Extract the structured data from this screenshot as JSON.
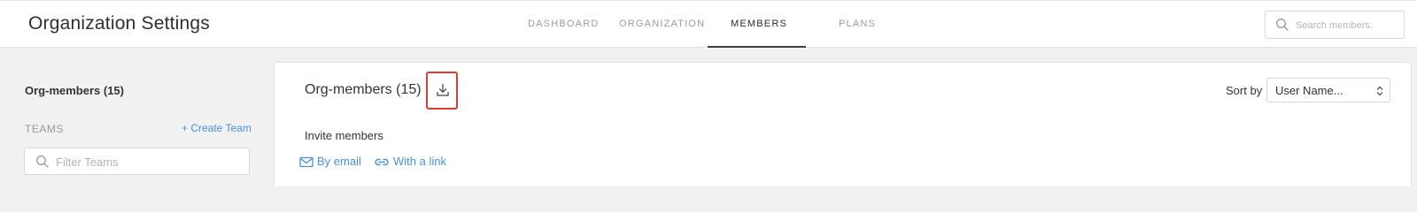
{
  "header": {
    "title": "Organization Settings",
    "tabs": [
      {
        "label": "DASHBOARD"
      },
      {
        "label": "ORGANIZATION"
      },
      {
        "label": "MEMBERS"
      },
      {
        "label": "PLANS"
      }
    ],
    "active_tab": "MEMBERS",
    "search": {
      "placeholder": "Search members.",
      "value": "",
      "icon": "search-icon"
    }
  },
  "sidebar": {
    "org_members_label": "Org-members (15)",
    "teams_heading": "TEAMS",
    "create_team_label": "+ Create Team",
    "filter": {
      "placeholder": "Filter Teams",
      "value": "",
      "icon": "search-icon"
    }
  },
  "main": {
    "title": "Org-members (15)",
    "download_icon": "download-icon",
    "sort": {
      "label": "Sort by",
      "selected": "User Name..."
    },
    "invite": {
      "heading": "Invite members",
      "by_email": {
        "label": "By email",
        "icon": "envelope-icon"
      },
      "with_link": {
        "label": "With a link",
        "icon": "link-icon"
      }
    }
  },
  "colors": {
    "accent_link": "#4a90d9",
    "highlight_box": "#e03b30",
    "background": "#f1f1f1"
  }
}
